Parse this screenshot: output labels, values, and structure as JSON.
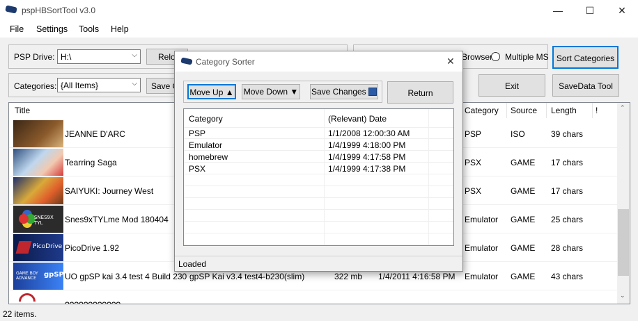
{
  "window": {
    "title": "pspHBSortTool v3.0",
    "controls": {
      "minimize": "—",
      "maximize": "☐",
      "close": "✕"
    }
  },
  "menu": [
    "File",
    "Settings",
    "Tools",
    "Help"
  ],
  "toolbar": {
    "psp_drive_label": "PSP Drive:",
    "psp_drive_value": "H:\\",
    "reload_label": "Reload",
    "browser_label": "Browser",
    "multiple_ms_label": "Multiple MS",
    "sort_categories_label": "Sort Categories",
    "categories_label": "Categories:",
    "categories_value": "{All Items}",
    "save_label": "Save Changes",
    "exit_label": "Exit",
    "savedata_label": "SaveData Tool"
  },
  "list": {
    "columns": [
      "Title",
      "Category",
      "Source",
      "Length",
      "!"
    ],
    "rows": [
      {
        "title": "JEANNE D'ARC",
        "category": "PSP",
        "source": "ISO",
        "length": "39 chars",
        "thumb": "#6b4a2a"
      },
      {
        "title": "Tearring Saga",
        "category": "PSX",
        "source": "GAME",
        "length": "17 chars",
        "thumb": "#8fb3d6"
      },
      {
        "title": "SAIYUKI: Journey West",
        "category": "PSX",
        "source": "GAME",
        "length": "17 chars",
        "thumb": "#c9a24a"
      },
      {
        "title": "Snes9xTYLme Mod 180404",
        "category": "Emulator",
        "source": "GAME",
        "length": "25 chars",
        "thumb": "#3a3a3a"
      },
      {
        "title": "PicoDrive 1.92",
        "category": "Emulator",
        "source": "GAME",
        "length": "28 chars",
        "thumb": "#1e3a8a"
      },
      {
        "title": "UO gpSP kai 3.4 test 4 Build 230",
        "description": "gpSP Kai v3.4 test4-b230(slim)",
        "size": "322 mb",
        "date": "1/4/2011 4:16:58 PM",
        "category": "Emulator",
        "source": "GAME",
        "length": "43 chars",
        "thumb": "#1d4ed8"
      },
      {
        "title": "????????????",
        "category": "",
        "source": "",
        "length": "",
        "thumb": "#ffffff"
      }
    ]
  },
  "status_bar": {
    "count": "22 items."
  },
  "dialog": {
    "title": "Category Sorter",
    "move_up_label": "Move Up",
    "move_down_label": "Move Down",
    "save_changes_label": "Save Changes",
    "return_label": "Return",
    "columns": [
      "Category",
      "(Relevant) Date"
    ],
    "rows": [
      {
        "category": "PSP",
        "date": "1/1/2008 12:00:30 AM"
      },
      {
        "category": "Emulator",
        "date": "1/4/1999 4:18:00 PM"
      },
      {
        "category": "homebrew",
        "date": "1/4/1999 4:17:58 PM"
      },
      {
        "category": "PSX",
        "date": "1/4/1999 4:17:38 PM"
      }
    ],
    "status": "Loaded",
    "close": "✕"
  },
  "colors": {
    "selection_border": "#0078d7",
    "title_text": "#444444"
  }
}
